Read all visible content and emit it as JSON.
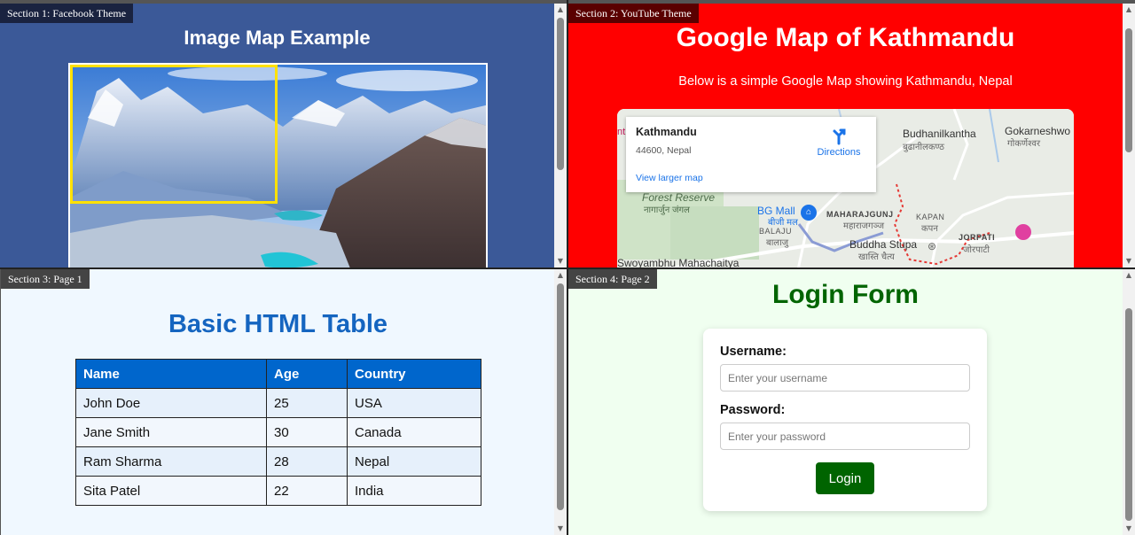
{
  "section1": {
    "label": "Section 1: Facebook Theme",
    "title": "Image Map Example",
    "image_alt": "mountain landscape"
  },
  "section2": {
    "label": "Section 2: YouTube Theme",
    "title": "Google Map of Kathmandu",
    "subtitle": "Below is a simple Google Map showing Kathmandu, Nepal",
    "map": {
      "place_name": "Kathmandu",
      "address": "44600, Nepal",
      "directions_label": "Directions",
      "larger_map_link": "View larger map",
      "labels": {
        "budhanilkantha": "Budhanilkantha",
        "budhanilkantha_dev": "बुढानीलकण्ठ",
        "gokarneshwor": "Gokarneshwo",
        "gokarneshwor_dev": "गोकर्णेश्वर",
        "forest": "Forest Reserve",
        "forest_dev": "नागार्जुन जंगल",
        "bgmall": "BG Mall",
        "bgmall_dev": "बीजी मल",
        "maharajgunj": "MAHARAJGUNJ",
        "maharajgunj_dev": "महाराजगञ्ज",
        "kapan": "KAPAN",
        "kapan_dev": "कपन",
        "balaju": "BALAJU",
        "balaju_dev": "बालाजु",
        "buddha": "Buddha Stupa",
        "buddha_dev": "खास्ति चैत्य",
        "jorpati": "JORPATI",
        "jorpati_dev": "जोरपाटी",
        "swayambhu": "Swoyambhu Mahachaitya",
        "edge_nt": "nt"
      }
    }
  },
  "section3": {
    "label": "Section 3: Page 1",
    "title": "Basic HTML Table",
    "headers": [
      "Name",
      "Age",
      "Country"
    ],
    "rows": [
      [
        "John Doe",
        "25",
        "USA"
      ],
      [
        "Jane Smith",
        "30",
        "Canada"
      ],
      [
        "Ram Sharma",
        "28",
        "Nepal"
      ],
      [
        "Sita Patel",
        "22",
        "India"
      ]
    ]
  },
  "section4": {
    "label": "Section 4: Page 2",
    "title": "Login Form",
    "username_label": "Username:",
    "username_placeholder": "Enter your username",
    "password_label": "Password:",
    "password_placeholder": "Enter your password",
    "button_label": "Login"
  },
  "colors": {
    "facebook_blue": "#3b5998",
    "youtube_red": "#ff0000",
    "table_header": "#0066cc",
    "login_green": "#006400"
  }
}
